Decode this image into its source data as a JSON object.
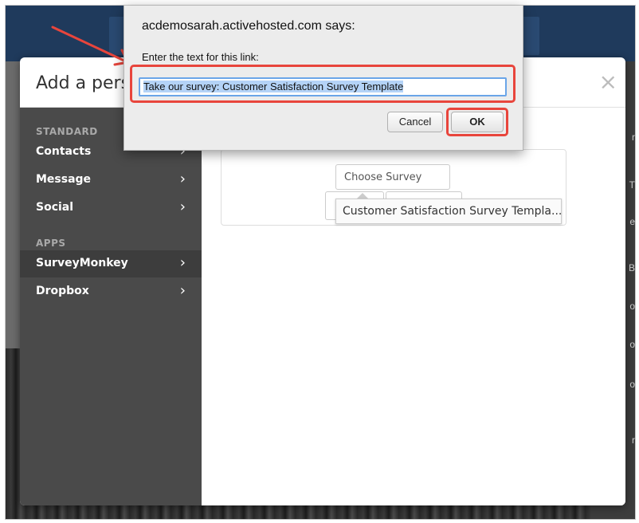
{
  "modal": {
    "title": "Add a pers",
    "close_symbol": "×",
    "sidebar": {
      "sections": [
        {
          "heading": "STANDARD",
          "items": [
            {
              "label": "Contacts",
              "chevron": "›"
            },
            {
              "label": "Message",
              "chevron": "›"
            },
            {
              "label": "Social",
              "chevron": "›"
            }
          ]
        },
        {
          "heading": "APPS",
          "items": [
            {
              "label": "SurveyMonkey",
              "chevron": "›",
              "active": true
            },
            {
              "label": "Dropbox",
              "chevron": "›"
            }
          ]
        }
      ]
    },
    "content": {
      "choose_survey_label": "Choose Survey",
      "tooltip_text": "Customer Satisfaction Survey Templa..."
    }
  },
  "dialog": {
    "title": "acdemosarah.activehosted.com says:",
    "prompt": "Enter the text for this link:",
    "input_value": "Take our survey: Customer Satisfaction Survey Template",
    "cancel_label": "Cancel",
    "ok_label": "OK"
  },
  "background": {
    "right_strip_letters": [
      "r",
      "T",
      "e",
      "B",
      "o",
      "o",
      "o",
      "r"
    ]
  },
  "colors": {
    "highlight": "#e8453c",
    "sidebar_bg": "#4a4a4a",
    "sidebar_active": "#3d3d3d",
    "header_bg": "#1f3a5c"
  },
  "icons": {
    "close": "close-icon",
    "chevron": "chevron-right-icon",
    "annotation_arrow": "arrow-icon"
  }
}
